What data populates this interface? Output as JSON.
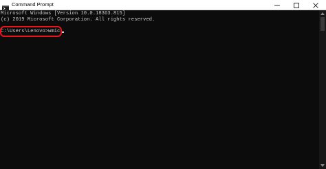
{
  "window": {
    "title": "Command Prompt",
    "icon": "cmd-icon",
    "controls": [
      "minimize-icon",
      "maximize-icon",
      "close-icon"
    ]
  },
  "console": {
    "lines": [
      "Microsoft Windows [Version 10.0.18363.815]",
      "(c) 2019 Microsoft Corporation. All rights reserved.",
      "C:\\Users\\Lenovo>wmic"
    ]
  },
  "colors": {
    "background": "#0c0c0c",
    "text": "#cccccc",
    "highlight": "#e8151a",
    "titlebar": "#ffffff"
  }
}
